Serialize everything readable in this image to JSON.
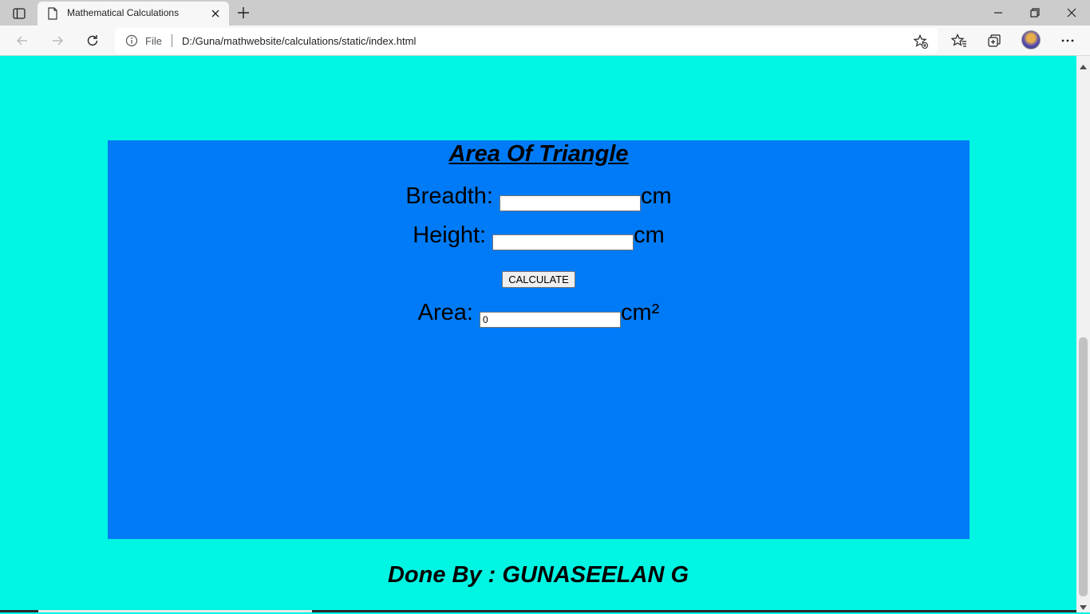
{
  "browser": {
    "tab_title": "Mathematical Calculations",
    "address_prefix": "File",
    "url": "D:/Guna/mathwebsite/calculations/static/index.html"
  },
  "page": {
    "title": "Area Of Triangle",
    "breadth_label": "Breadth: ",
    "breadth_value": "",
    "breadth_unit": "cm",
    "height_label": "Height: ",
    "height_value": "",
    "height_unit": "cm",
    "calculate_label": "CALCULATE",
    "area_label": "Area: ",
    "area_value": "0",
    "area_unit": "cm²",
    "footer": "Done By : GUNASEELAN G"
  },
  "colors": {
    "page_background": "#00F5E3",
    "panel_background": "#007BF7"
  }
}
